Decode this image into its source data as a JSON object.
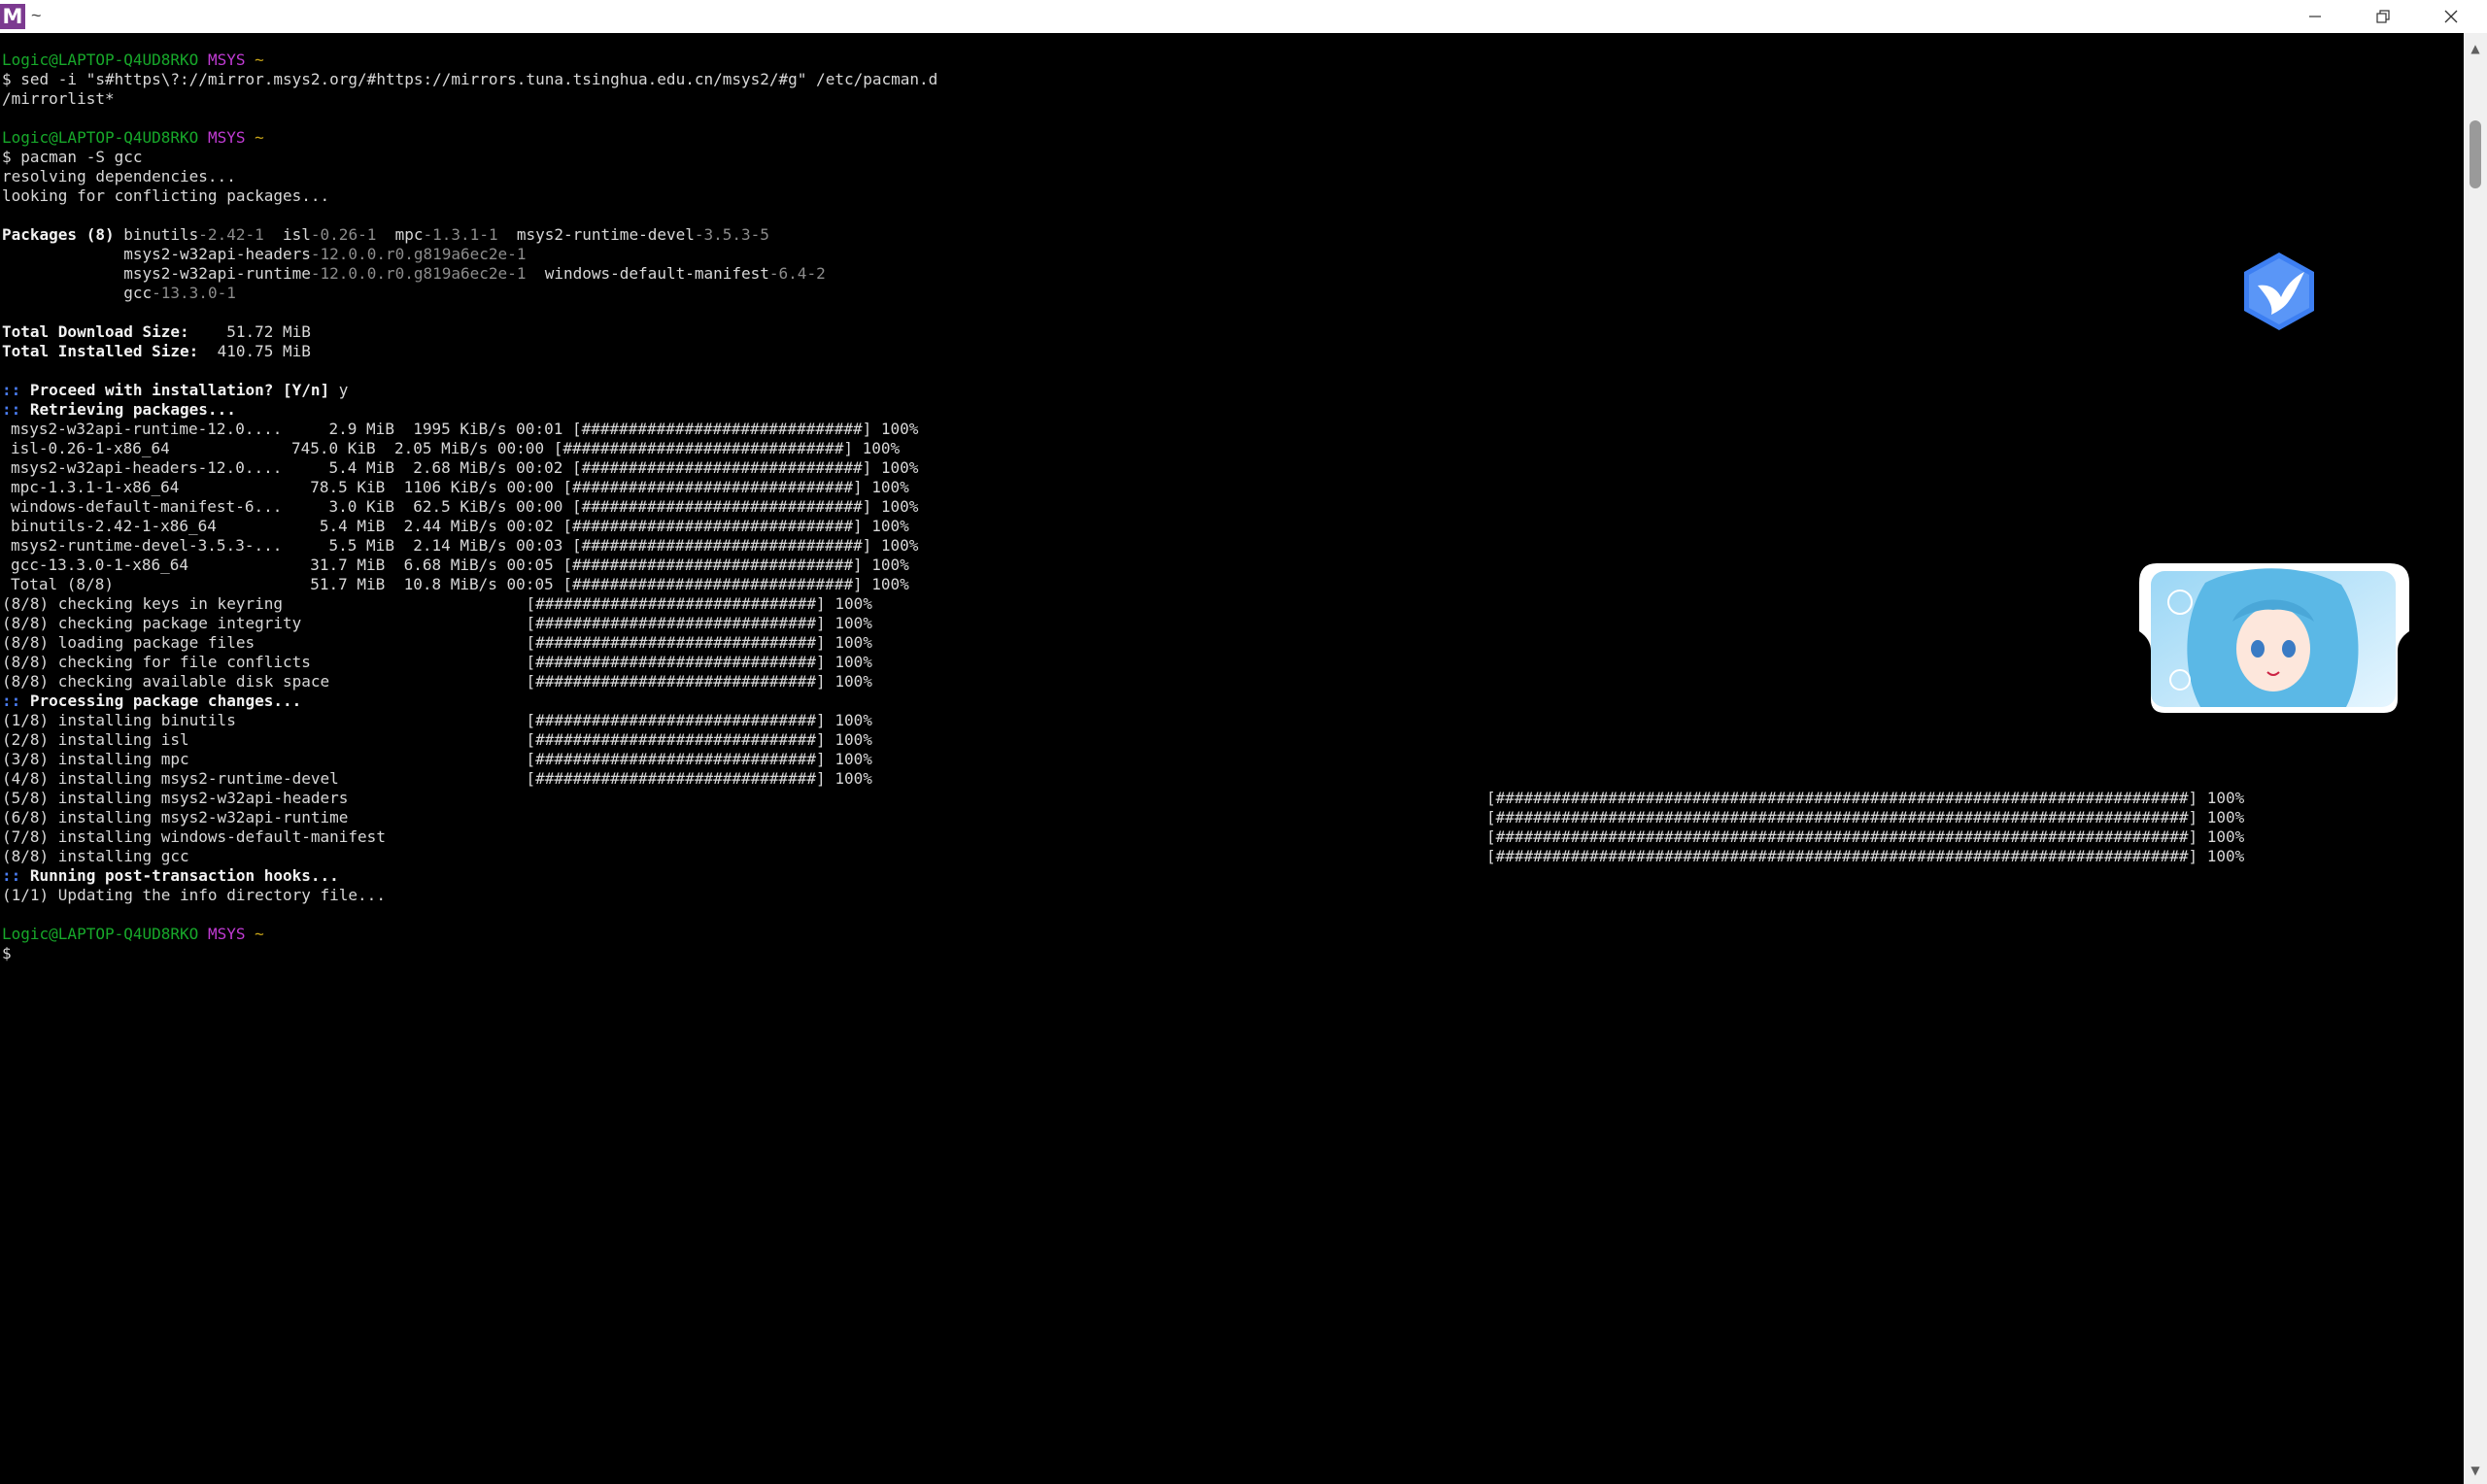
{
  "window": {
    "title": "~",
    "app_icon_letter": "M",
    "minimize_label": "—",
    "maximize_label": "❐",
    "close_label": "✕"
  },
  "prompts": {
    "user": "Logic@LAPTOP-Q4UD8RKO",
    "env": "MSYS",
    "path": "~"
  },
  "commands": {
    "sed_line1": "$ sed -i \"s#https\\?://mirror.msys2.org/#https://mirrors.tuna.tsinghua.edu.cn/msys2/#g\" /etc/pacman.d",
    "sed_line2": "/mirrorlist*",
    "pacman": "$ pacman -S gcc",
    "final_prompt": "$"
  },
  "output": {
    "resolving": "resolving dependencies...",
    "conflicts": "looking for conflicting packages...",
    "packages_label": "Packages (8)",
    "packages": [
      {
        "name": "binutils",
        "ver": "-2.42-1"
      },
      {
        "name": "isl",
        "ver": "-0.26-1"
      },
      {
        "name": "mpc",
        "ver": "-1.3.1-1"
      },
      {
        "name": "msys2-runtime-devel",
        "ver": "-3.5.3-5"
      },
      {
        "name": "msys2-w32api-headers",
        "ver": "-12.0.0.r0.g819a6ec2e-1"
      },
      {
        "name": "msys2-w32api-runtime",
        "ver": "-12.0.0.r0.g819a6ec2e-1"
      },
      {
        "name": "windows-default-manifest",
        "ver": "-6.4-2"
      },
      {
        "name": "gcc",
        "ver": "-13.3.0-1"
      }
    ],
    "download_label": "Total Download Size:",
    "download_value": "51.72 MiB",
    "installed_label": "Total Installed Size:",
    "installed_value": "410.75 MiB",
    "proceed": "Proceed with installation? [Y/n]",
    "proceed_answer": "y",
    "retrieving": "Retrieving packages...",
    "processing": "Processing package changes...",
    "hooks": "Running post-transaction hooks...",
    "hook_item": "(1/1) Updating the info directory file...",
    "arrow": "::"
  },
  "downloads": [
    "msys2-w32api-runtime-12.0....     2.9 MiB  1995 KiB/s 00:01 [##############################] 100%",
    "isl-0.26-1-x86_64             745.0 KiB  2.05 MiB/s 00:00 [##############################] 100%",
    "msys2-w32api-headers-12.0....     5.4 MiB  2.68 MiB/s 00:02 [##############################] 100%",
    "mpc-1.3.1-1-x86_64              78.5 KiB  1106 KiB/s 00:00 [##############################] 100%",
    "windows-default-manifest-6...     3.0 KiB  62.5 KiB/s 00:00 [##############################] 100%",
    "binutils-2.42-1-x86_64           5.4 MiB  2.44 MiB/s 00:02 [##############################] 100%",
    "msys2-runtime-devel-3.5.3-...     5.5 MiB  2.14 MiB/s 00:03 [##############################] 100%",
    "gcc-13.3.0-1-x86_64             31.7 MiB  6.68 MiB/s 00:05 [##############################] 100%",
    "Total (8/8)                     51.7 MiB  10.8 MiB/s 00:05 [##############################] 100%"
  ],
  "checks": [
    "(8/8) checking keys in keyring                          [##############################] 100%",
    "(8/8) checking package integrity                        [##############################] 100%",
    "(8/8) loading package files                             [##############################] 100%",
    "(8/8) checking for file conflicts                       [##############################] 100%",
    "(8/8) checking available disk space                     [##############################] 100%"
  ],
  "installs_left": [
    "(1/8) installing binutils                               [##############################] 100%",
    "(2/8) installing isl                                    [##############################] 100%",
    "(3/8) installing mpc                                    [##############################] 100%",
    "(4/8) installing msys2-runtime-devel                    [##############################] 100%"
  ],
  "installs_right_names": [
    "(5/8) installing msys2-w32api-headers",
    "(6/8) installing msys2-w32api-runtime",
    "(7/8) installing windows-default-manifest",
    "(8/8) installing gcc"
  ],
  "installs_right_bars": [
    "[##########################################################################] 100%",
    "[##########################################################################] 100%",
    "[##########################################################################] 100%",
    "[##########################################################################] 100%"
  ],
  "colors": {
    "user": "#17a82a",
    "env": "#c13bd4",
    "path": "#c8a417",
    "arrow": "#4a7cf0",
    "bird": "#3d7ff2"
  }
}
